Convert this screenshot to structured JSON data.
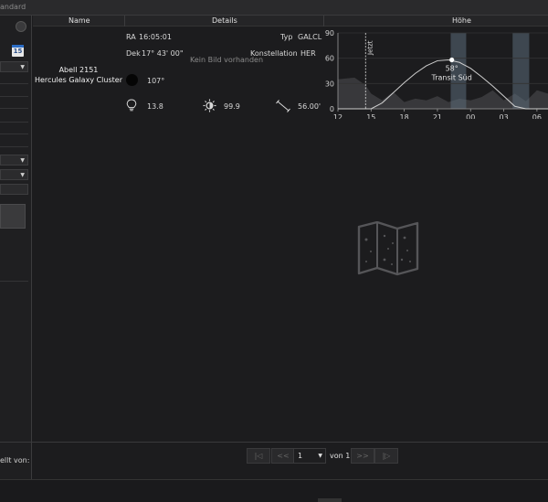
{
  "topbar": {
    "label": "andard"
  },
  "sidebar": {
    "calendar_day": "15",
    "creator_label": "ellt von:"
  },
  "table": {
    "headers": {
      "name": "Name",
      "details": "Details",
      "altitude": "Höhe"
    },
    "row": {
      "name_line1": "Abell 2151",
      "name_line2": "Hercules Galaxy Cluster",
      "ra_label": "RA",
      "ra_value": "16:05:01",
      "dec_label": "Dek",
      "dec_value": "17° 43' 00\"",
      "type_label": "Typ",
      "type_value": "GALCL",
      "constellation_label": "Konstellation",
      "constellation_value": "HER",
      "no_image": "Kein Bild vorhanden",
      "moon_angle": "107°",
      "magnitude": "13.8",
      "surface_brightness": "99.9",
      "size": "56.00'"
    }
  },
  "chart_data": {
    "type": "line",
    "title": "",
    "xlabel": "",
    "ylabel": "",
    "x_ticks": [
      "12",
      "15",
      "18",
      "21",
      "00",
      "03",
      "06"
    ],
    "y_ticks": [
      0,
      30,
      60,
      90
    ],
    "ylim": [
      0,
      90
    ],
    "xlim_hours": [
      12,
      31
    ],
    "series": [
      {
        "x": [
          12,
          13,
          14,
          15,
          16,
          17,
          18,
          19,
          20,
          21,
          22,
          23,
          24,
          25,
          26,
          27,
          28,
          29,
          30,
          31
        ],
        "y": [
          -32,
          -25,
          -16,
          -5,
          7,
          19,
          31,
          42,
          51,
          57,
          58,
          55,
          48,
          38,
          27,
          15,
          3,
          -9,
          -20,
          -28
        ]
      }
    ],
    "horizon_profile": {
      "x": [
        12,
        13.5,
        14.5,
        15,
        16,
        17,
        18,
        19,
        20,
        21,
        22,
        23,
        24,
        25,
        26,
        27,
        28,
        29,
        30,
        31
      ],
      "y": [
        35,
        37,
        28,
        18,
        10,
        20,
        8,
        12,
        10,
        15,
        8,
        12,
        10,
        14,
        22,
        10,
        18,
        9,
        22,
        18
      ]
    },
    "night_bands": [
      [
        22.2,
        23.6
      ],
      [
        27.8,
        29.3
      ]
    ],
    "now_label": "Jetzt",
    "now_hour": 14.5,
    "transit": {
      "hour": 22.3,
      "altitude": 58,
      "label": "58°",
      "sublabel": "Transit Süd"
    },
    "colors": {
      "curve": "#cfcfcf",
      "horizon": "#3c3c3e",
      "band": "#5b6b7a",
      "grid": "#333333",
      "axis": "#9a9a9a"
    }
  },
  "pager": {
    "first": "|◁",
    "prev": "<<",
    "page": "1",
    "of_label": "von",
    "total": "1",
    "next": ">>",
    "last": "|▷"
  },
  "icons": {
    "moon": "moon-icon",
    "magnitude": "lightbulb-icon",
    "surface_brightness": "sun-icon",
    "size": "ruler-icon",
    "empty_state": "star-map-icon"
  }
}
